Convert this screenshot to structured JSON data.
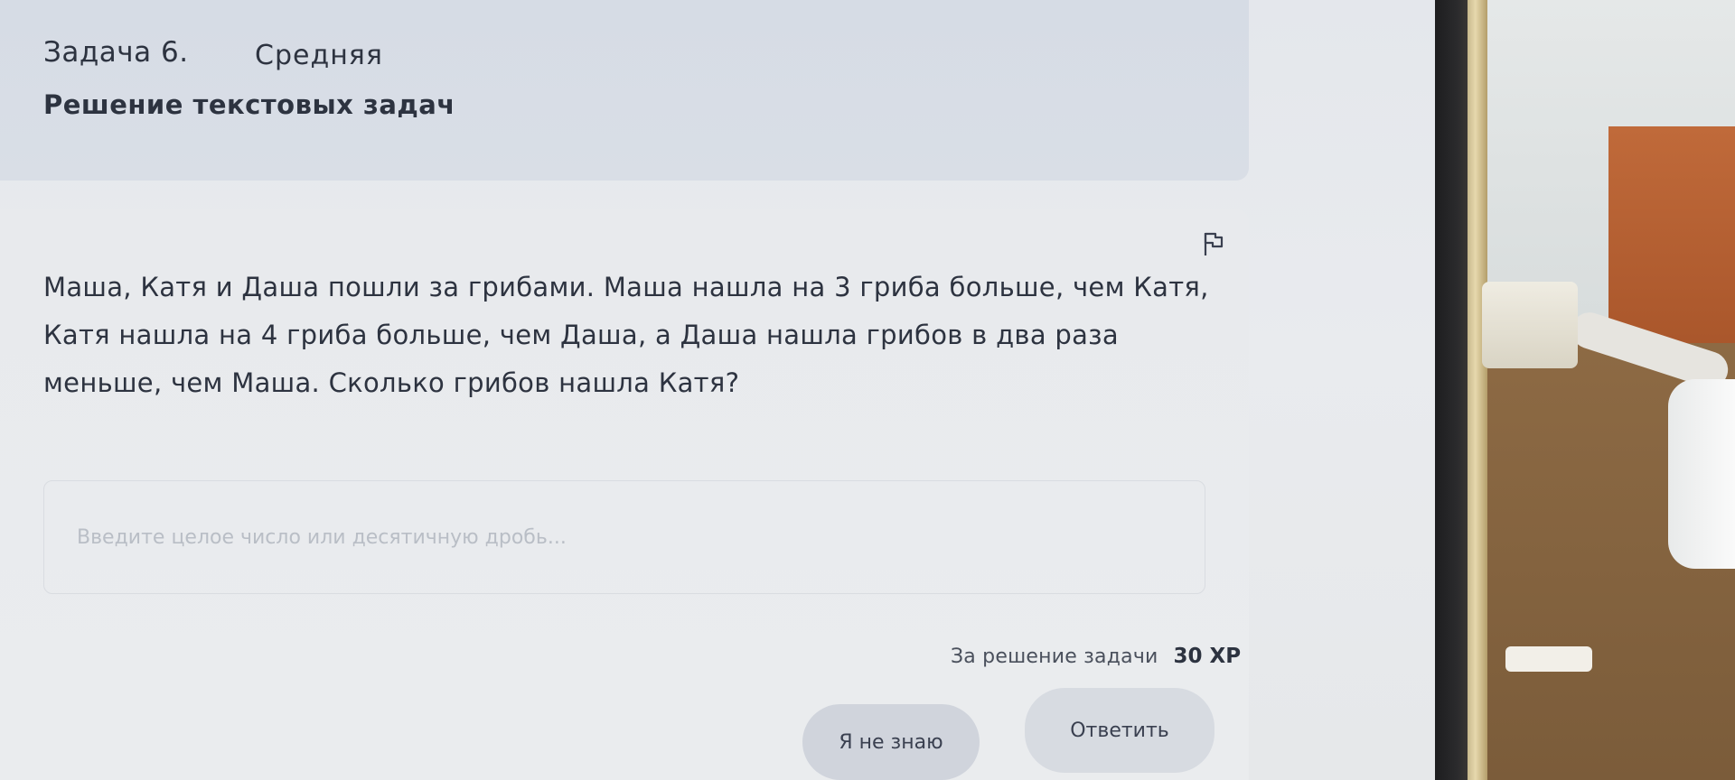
{
  "header": {
    "task_number": "Задача 6.",
    "difficulty": "Средняя",
    "topic": "Решение текстовых задач"
  },
  "task": {
    "question": "Маша, Катя и Даша пошли за грибами. Маша нашла на 3 гриба больше, чем Катя, Катя нашла на 4 гриба больше, чем Даша, а Даша нашла грибов в два раза меньше, чем Маша. Сколько грибов нашла Катя?",
    "flag_icon": "flag-icon"
  },
  "answer": {
    "placeholder": "Введите целое число или десятичную дробь...",
    "value": ""
  },
  "reward": {
    "label": "За решение задачи",
    "value": "30 XP"
  },
  "buttons": {
    "dont_know": "Я не знаю",
    "submit": "Ответить"
  }
}
